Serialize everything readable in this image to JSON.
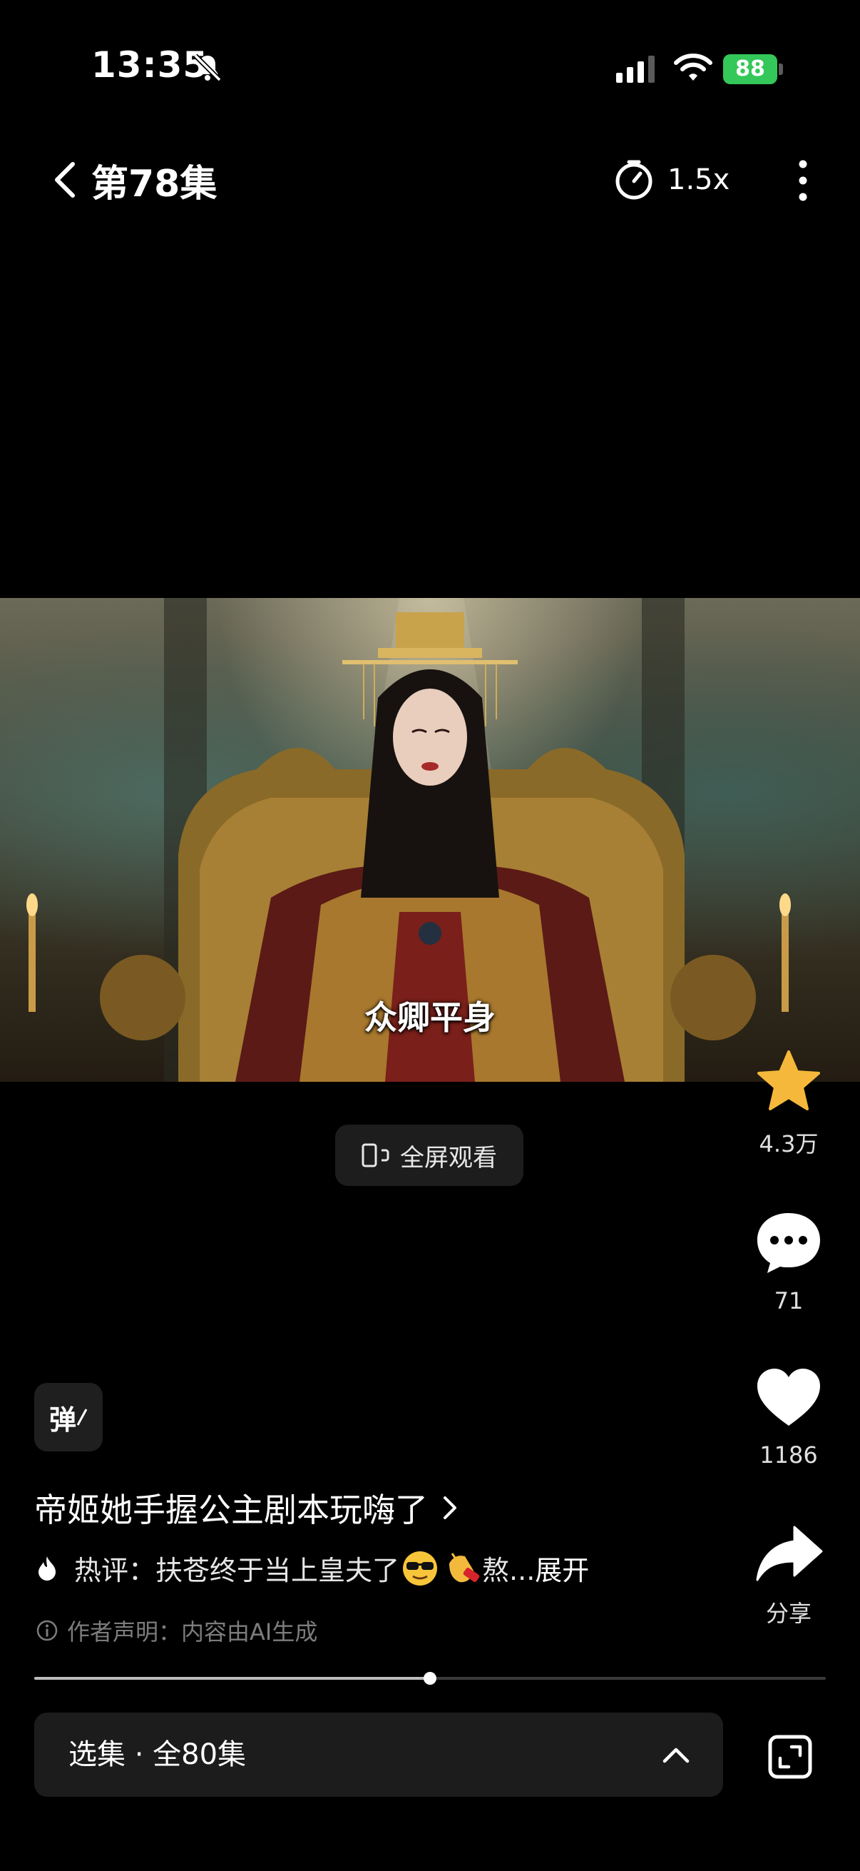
{
  "status_bar": {
    "time": "13:35",
    "battery": "88",
    "battery_color": "#34c759"
  },
  "nav": {
    "episode_title": "第78集",
    "speed": "1.5x"
  },
  "video": {
    "subtitle": "众卿平身"
  },
  "fullscreen": {
    "label": "全屏观看"
  },
  "rail": {
    "favorite_count": "4.3万",
    "favorite_color": "#f5b83a",
    "comment_count": "71",
    "like_count": "1186",
    "share_label": "分享"
  },
  "danmaku": {
    "label": "弹"
  },
  "info": {
    "series_title": "帝姬她手握公主剧本玩嗨了",
    "hot_label": "热评：",
    "hot_text": "扶苍终于当上皇夫了",
    "hot_tail": "熬...",
    "expand": "展开",
    "disclaimer": "作者声明：内容由AI生成"
  },
  "progress": {
    "fraction": 0.5
  },
  "episodes": {
    "selector_label": "选集 · 全80集"
  },
  "icons": [
    "mute-icon",
    "signal-icon",
    "wifi-icon",
    "back-icon",
    "timer-icon",
    "more-icon",
    "fullscreen-icon",
    "star-icon",
    "comment-icon",
    "heart-icon",
    "share-icon",
    "flame-icon",
    "info-icon",
    "chevron-up-icon",
    "expand-icon"
  ]
}
